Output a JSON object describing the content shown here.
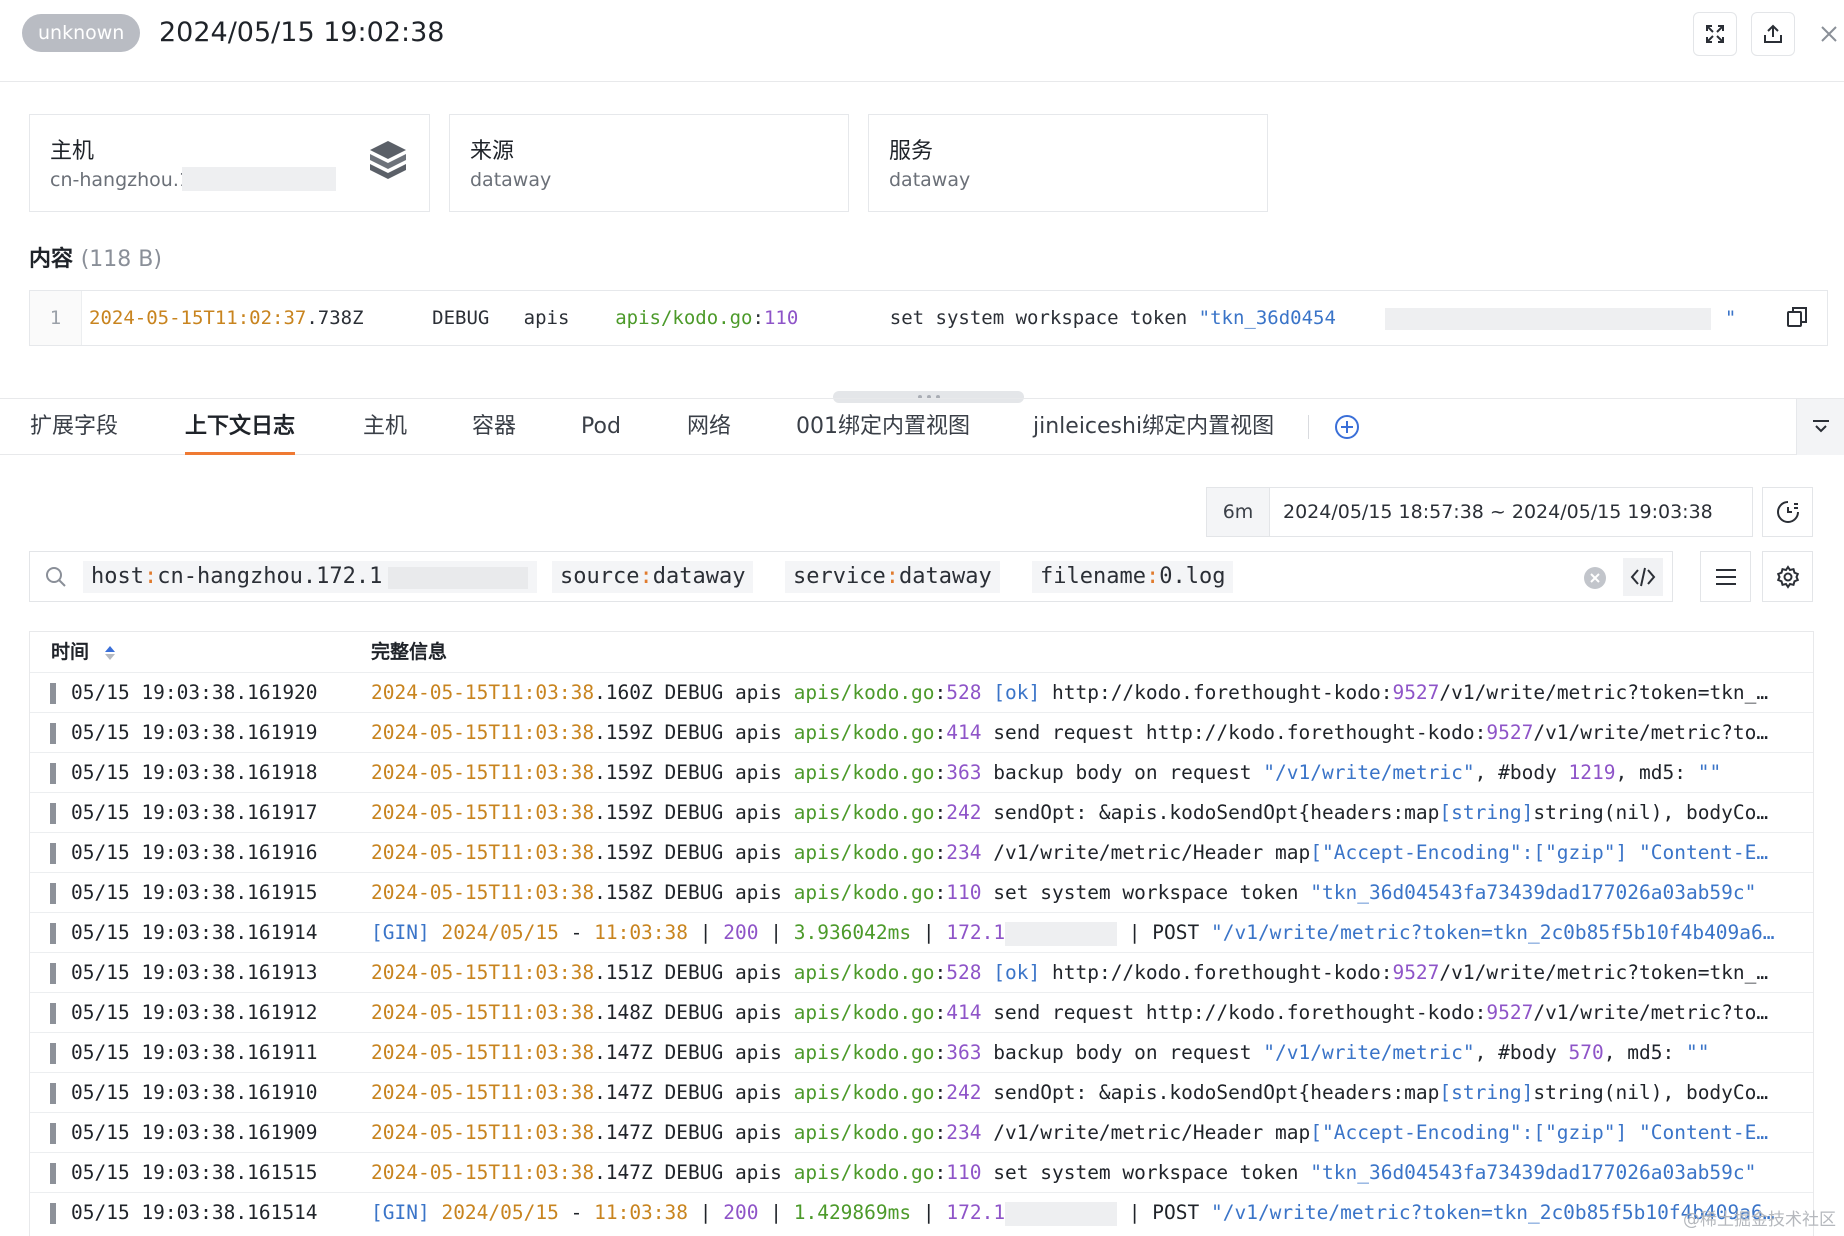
{
  "header": {
    "status": "unknown",
    "timestamp": "2024/05/15 19:02:38"
  },
  "cards": [
    {
      "title": "主机",
      "value": "cn-hangzhou.1"
    },
    {
      "title": "来源",
      "value": "dataway"
    },
    {
      "title": "服务",
      "value": "dataway"
    }
  ],
  "content": {
    "heading": "内容",
    "size": "(118 B)",
    "line_number": "1",
    "segments": [
      {
        "text": "2024-05-15T11:02:37",
        "color": "orange"
      },
      {
        "text": ".738Z      DEBUG   apis    ",
        "color": "default"
      },
      {
        "text": "apis/kodo.go",
        "color": "green"
      },
      {
        "text": ":",
        "color": "default"
      },
      {
        "text": "110",
        "color": "purple"
      },
      {
        "text": "        set system workspace token ",
        "color": "default"
      },
      {
        "text": "\"tkn_36d0454",
        "color": "blue"
      },
      {
        "text": "                                  ",
        "color": "default"
      },
      {
        "text": "\"",
        "color": "blue"
      }
    ]
  },
  "tabs": [
    "扩展字段",
    "上下文日志",
    "主机",
    "容器",
    "Pod",
    "网络",
    "001绑定内置视图",
    "jinleiceshi绑定内置视图"
  ],
  "active_tab": 1,
  "time_range": {
    "short": "6m",
    "range": "2024/05/15 18:57:38 ~ 2024/05/15 19:03:38"
  },
  "search": {
    "chips": [
      {
        "key": "host",
        "value": "cn-hangzhou.172.1"
      },
      {
        "key": "source",
        "value": "dataway"
      },
      {
        "key": "service",
        "value": "dataway"
      },
      {
        "key": "filename",
        "value": "0.log"
      }
    ]
  },
  "table": {
    "columns": [
      "时间",
      "完整信息"
    ],
    "rows": [
      {
        "time": "05/15 19:03:38.161920",
        "segs": [
          [
            "o",
            "2024-05-15T11:03:38"
          ],
          [
            "d",
            ".160Z DEBUG apis "
          ],
          [
            "g",
            "apis/kodo.go"
          ],
          [
            "d",
            ":"
          ],
          [
            "p",
            "528"
          ],
          [
            "d",
            " "
          ],
          [
            "b",
            "[ok]"
          ],
          [
            "d",
            " http://kodo.forethought-kodo:"
          ],
          [
            "p",
            "9527"
          ],
          [
            "d",
            "/v1/write/metric?token=tkn_…"
          ]
        ]
      },
      {
        "time": "05/15 19:03:38.161919",
        "segs": [
          [
            "o",
            "2024-05-15T11:03:38"
          ],
          [
            "d",
            ".159Z DEBUG apis "
          ],
          [
            "g",
            "apis/kodo.go"
          ],
          [
            "d",
            ":"
          ],
          [
            "p",
            "414"
          ],
          [
            "d",
            " send request http://kodo.forethought-kodo:"
          ],
          [
            "p",
            "9527"
          ],
          [
            "d",
            "/v1/write/metric?to…"
          ]
        ]
      },
      {
        "time": "05/15 19:03:38.161918",
        "segs": [
          [
            "o",
            "2024-05-15T11:03:38"
          ],
          [
            "d",
            ".159Z DEBUG apis "
          ],
          [
            "g",
            "apis/kodo.go"
          ],
          [
            "d",
            ":"
          ],
          [
            "p",
            "363"
          ],
          [
            "d",
            " backup body on request "
          ],
          [
            "b",
            "\"/v1/write/metric\""
          ],
          [
            "d",
            ", #body "
          ],
          [
            "p",
            "1219"
          ],
          [
            "d",
            ", md5: "
          ],
          [
            "b",
            "\"\""
          ]
        ]
      },
      {
        "time": "05/15 19:03:38.161917",
        "segs": [
          [
            "o",
            "2024-05-15T11:03:38"
          ],
          [
            "d",
            ".159Z DEBUG apis "
          ],
          [
            "g",
            "apis/kodo.go"
          ],
          [
            "d",
            ":"
          ],
          [
            "p",
            "242"
          ],
          [
            "d",
            " sendOpt: &apis.kodoSendOpt{headers:map"
          ],
          [
            "b",
            "[string]"
          ],
          [
            "d",
            "string(nil), bodyCo…"
          ]
        ]
      },
      {
        "time": "05/15 19:03:38.161916",
        "segs": [
          [
            "o",
            "2024-05-15T11:03:38"
          ],
          [
            "d",
            ".159Z DEBUG apis "
          ],
          [
            "g",
            "apis/kodo.go"
          ],
          [
            "d",
            ":"
          ],
          [
            "p",
            "234"
          ],
          [
            "d",
            " /v1/write/metric/Header map"
          ],
          [
            "b",
            "[\"Accept-Encoding\":[\"gzip\"]"
          ],
          [
            "d",
            " "
          ],
          [
            "b",
            "\"Content-E…"
          ]
        ]
      },
      {
        "time": "05/15 19:03:38.161915",
        "segs": [
          [
            "o",
            "2024-05-15T11:03:38"
          ],
          [
            "d",
            ".158Z DEBUG apis "
          ],
          [
            "g",
            "apis/kodo.go"
          ],
          [
            "d",
            ":"
          ],
          [
            "p",
            "110"
          ],
          [
            "d",
            " set system workspace token "
          ],
          [
            "b",
            "\"tkn_36d04543fa73439dad177026a03ab59c\""
          ]
        ]
      },
      {
        "time": "05/15 19:03:38.161914",
        "segs": [
          [
            "b",
            "[GIN]"
          ],
          [
            "d",
            " "
          ],
          [
            "o",
            "2024/05/15"
          ],
          [
            "d",
            " - "
          ],
          [
            "o",
            "11:03:38"
          ],
          [
            "d",
            " | "
          ],
          [
            "p",
            "200"
          ],
          [
            "d",
            " | "
          ],
          [
            "g",
            "3.936042ms"
          ],
          [
            "d",
            " | "
          ],
          [
            "p",
            "172.1"
          ],
          [
            "r",
            ""
          ],
          [
            "d",
            " | POST "
          ],
          [
            "b",
            "\"/v1/write/metric?token=tkn_2c0b85f5b10f4b409a6…"
          ]
        ]
      },
      {
        "time": "05/15 19:03:38.161913",
        "segs": [
          [
            "o",
            "2024-05-15T11:03:38"
          ],
          [
            "d",
            ".151Z DEBUG apis "
          ],
          [
            "g",
            "apis/kodo.go"
          ],
          [
            "d",
            ":"
          ],
          [
            "p",
            "528"
          ],
          [
            "d",
            " "
          ],
          [
            "b",
            "[ok]"
          ],
          [
            "d",
            " http://kodo.forethought-kodo:"
          ],
          [
            "p",
            "9527"
          ],
          [
            "d",
            "/v1/write/metric?token=tkn_…"
          ]
        ]
      },
      {
        "time": "05/15 19:03:38.161912",
        "segs": [
          [
            "o",
            "2024-05-15T11:03:38"
          ],
          [
            "d",
            ".148Z DEBUG apis "
          ],
          [
            "g",
            "apis/kodo.go"
          ],
          [
            "d",
            ":"
          ],
          [
            "p",
            "414"
          ],
          [
            "d",
            " send request http://kodo.forethought-kodo:"
          ],
          [
            "p",
            "9527"
          ],
          [
            "d",
            "/v1/write/metric?to…"
          ]
        ]
      },
      {
        "time": "05/15 19:03:38.161911",
        "segs": [
          [
            "o",
            "2024-05-15T11:03:38"
          ],
          [
            "d",
            ".147Z DEBUG apis "
          ],
          [
            "g",
            "apis/kodo.go"
          ],
          [
            "d",
            ":"
          ],
          [
            "p",
            "363"
          ],
          [
            "d",
            " backup body on request "
          ],
          [
            "b",
            "\"/v1/write/metric\""
          ],
          [
            "d",
            ", #body "
          ],
          [
            "p",
            "570"
          ],
          [
            "d",
            ", md5: "
          ],
          [
            "b",
            "\"\""
          ]
        ]
      },
      {
        "time": "05/15 19:03:38.161910",
        "segs": [
          [
            "o",
            "2024-05-15T11:03:38"
          ],
          [
            "d",
            ".147Z DEBUG apis "
          ],
          [
            "g",
            "apis/kodo.go"
          ],
          [
            "d",
            ":"
          ],
          [
            "p",
            "242"
          ],
          [
            "d",
            " sendOpt: &apis.kodoSendOpt{headers:map"
          ],
          [
            "b",
            "[string]"
          ],
          [
            "d",
            "string(nil), bodyCo…"
          ]
        ]
      },
      {
        "time": "05/15 19:03:38.161909",
        "segs": [
          [
            "o",
            "2024-05-15T11:03:38"
          ],
          [
            "d",
            ".147Z DEBUG apis "
          ],
          [
            "g",
            "apis/kodo.go"
          ],
          [
            "d",
            ":"
          ],
          [
            "p",
            "234"
          ],
          [
            "d",
            " /v1/write/metric/Header map"
          ],
          [
            "b",
            "[\"Accept-Encoding\":[\"gzip\"]"
          ],
          [
            "d",
            " "
          ],
          [
            "b",
            "\"Content-E…"
          ]
        ]
      },
      {
        "time": "05/15 19:03:38.161515",
        "segs": [
          [
            "o",
            "2024-05-15T11:03:38"
          ],
          [
            "d",
            ".147Z DEBUG apis "
          ],
          [
            "g",
            "apis/kodo.go"
          ],
          [
            "d",
            ":"
          ],
          [
            "p",
            "110"
          ],
          [
            "d",
            " set system workspace token "
          ],
          [
            "b",
            "\"tkn_36d04543fa73439dad177026a03ab59c\""
          ]
        ]
      },
      {
        "time": "05/15 19:03:38.161514",
        "segs": [
          [
            "b",
            "[GIN]"
          ],
          [
            "d",
            " "
          ],
          [
            "o",
            "2024/05/15"
          ],
          [
            "d",
            " - "
          ],
          [
            "o",
            "11:03:38"
          ],
          [
            "d",
            " | "
          ],
          [
            "p",
            "200"
          ],
          [
            "d",
            " | "
          ],
          [
            "g",
            "1.429869ms"
          ],
          [
            "d",
            " | "
          ],
          [
            "p",
            "172.1"
          ],
          [
            "r",
            ""
          ],
          [
            "d",
            " | POST "
          ],
          [
            "b",
            "\"/v1/write/metric?token=tkn_2c0b85f5b10f4b409a6…"
          ]
        ]
      }
    ]
  },
  "watermark": "@稀土掘金技术社区",
  "colors": {
    "accent": "#ef7a33",
    "orange": "#c8841f",
    "green": "#4c9a2a",
    "purple": "#8e54c8",
    "blue": "#3a74c8",
    "status_pill": "#b9bcc3"
  },
  "icons": {
    "fullscreen": "expand-icon",
    "share": "share-icon",
    "close": "close-icon",
    "host": "cube-stack-icon",
    "copy": "copy-icon",
    "add_tab": "plus-circle-icon",
    "tab_more": "collapse-icon",
    "history": "history-icon",
    "search": "search-icon",
    "clear": "clear-icon",
    "code": "code-icon",
    "list": "list-icon",
    "settings": "gear-icon",
    "sort": "sort-icon"
  }
}
